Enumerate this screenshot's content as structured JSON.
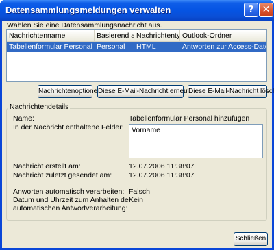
{
  "window": {
    "title": "Datensammlungsmeldungen verwalten",
    "help_symbol": "?",
    "close_symbol": "✕"
  },
  "instruction": "Wählen Sie eine Datensammlungsnachricht aus.",
  "list": {
    "columns": [
      "Nachrichtenname",
      "Basierend auf",
      "Nachrichtentyp",
      "Outlook-Ordner"
    ],
    "rows": [
      {
        "name": "Tabellenformular Personal hin...",
        "based_on": "Personal",
        "type": "HTML",
        "folder": "Antworten zur Access-Datensa...",
        "selected": true
      }
    ]
  },
  "buttons": {
    "options": "Nachrichtenoptionen",
    "resend": "Diese E-Mail-Nachricht erneut senden",
    "delete": "Diese E-Mail-Nachricht löschen",
    "close": "Schließen"
  },
  "details": {
    "legend": "Nachrichtendetails",
    "name_label": "Name:",
    "name_value": "Tabellenformular Personal hinzufügen",
    "fields_label": "In der Nachricht enthaltene Felder:",
    "fields_value": "Vorname",
    "created_label": "Nachricht erstellt am:",
    "created_value": "12.07.2006 11:38:07",
    "sent_label": "Nachricht zuletzt gesendet am:",
    "sent_value": "12.07.2006 11:38:07",
    "auto_label": "Anworten automatisch verarbeiten:",
    "auto_value": "Falsch",
    "datetime_label_line1": "Datum und Uhrzeit zum Anhalten der",
    "datetime_label_line2": "automatischen Antwortverarbeitung:",
    "datetime_value": "Kein"
  },
  "colors": {
    "titlebar": "#0554e3",
    "dialog_bg": "#ece9d8",
    "selection": "#316ac5"
  }
}
